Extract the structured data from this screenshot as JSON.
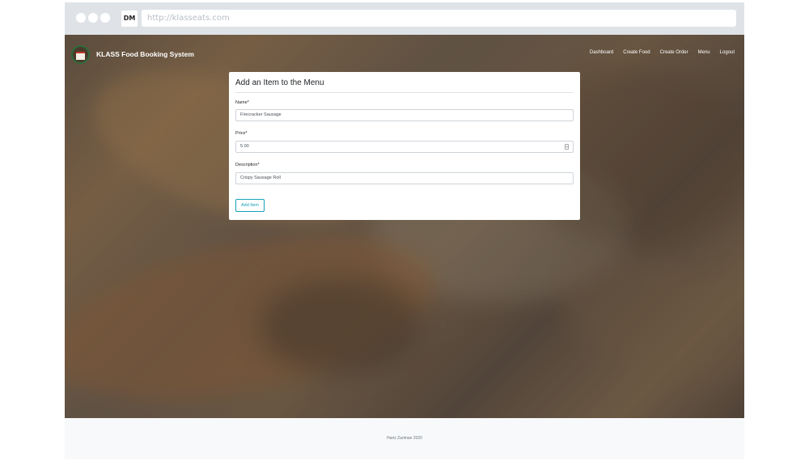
{
  "browser": {
    "badge": "DM",
    "url_placeholder": "http://klasseats.com"
  },
  "app": {
    "brand_title": "KLASS Food Booking System"
  },
  "nav": {
    "items": [
      "Dashboard",
      "Create Food",
      "Create Order",
      "Menu",
      "Logout"
    ]
  },
  "form": {
    "title": "Add an Item to the Menu",
    "name_label": "Name*",
    "name_value": "Firecracker Sausage",
    "price_label": "Price*",
    "price_value": "5.00",
    "description_label": "Description*",
    "description_value": "Crispy Sausage Roll",
    "submit_label": "Add Item"
  },
  "footer": {
    "text": "Hariz Zariman 2020"
  },
  "colors": {
    "accent": "#17a2b8",
    "chrome": "#dfe3e7",
    "footer_bg": "#f8f9fa"
  }
}
